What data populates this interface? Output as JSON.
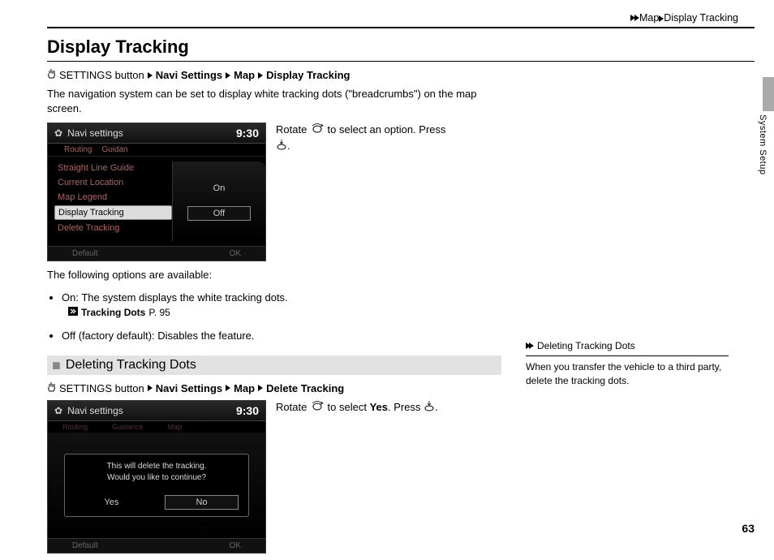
{
  "breadcrumb": {
    "items": [
      "Map",
      "Display Tracking"
    ]
  },
  "page": {
    "title": "Display Tracking",
    "number": "63",
    "section": "System Setup"
  },
  "navpath1": {
    "prefix": "SETTINGS button",
    "items": [
      "Navi Settings",
      "Map",
      "Display Tracking"
    ]
  },
  "intro": "The navigation system can be set to display white tracking dots (\"breadcrumbs\") on the map screen.",
  "screenshot1": {
    "title": "Navi settings",
    "clock": "9:30",
    "tabs": [
      "Routing",
      "Guidan"
    ],
    "list": [
      "Straight Line Guide",
      "Current Location",
      "Map Legend",
      "Display Tracking",
      "Delete Tracking"
    ],
    "active_index": 3,
    "options": [
      "On",
      "Off"
    ],
    "selected_option_index": 1,
    "footer": [
      "Default",
      "OK"
    ]
  },
  "instruct1": {
    "rotate_pre": "Rotate ",
    "rotate_post": " to select an option. Press ",
    "end": "."
  },
  "options_intro": "The following options are available:",
  "opt_on": {
    "label": "On",
    "desc": ": The system displays the white tracking dots."
  },
  "ref1": {
    "label": "Tracking Dots",
    "page": "P. 95"
  },
  "opt_off": {
    "label": "Off",
    "desc": " (factory default): Disables the feature."
  },
  "subheading": "Deleting Tracking Dots",
  "navpath2": {
    "prefix": "SETTINGS button",
    "items": [
      "Navi Settings",
      "Map",
      "Delete Tracking"
    ]
  },
  "screenshot2": {
    "title": "Navi settings",
    "clock": "9:30",
    "tabs": [
      "Routing",
      "Guidance",
      "Map"
    ],
    "msg1": "This will delete the tracking.",
    "msg2": "Would you like to continue?",
    "btns": [
      "Yes",
      "No"
    ],
    "selected_btn_index": 1,
    "footer": [
      "Default",
      "OK"
    ]
  },
  "instruct2": {
    "rotate_pre": "Rotate ",
    "mid1": " to select ",
    "yes": "Yes",
    "mid2": ". Press ",
    "end": "."
  },
  "sidenote": {
    "title": "Deleting Tracking Dots",
    "body": "When you transfer the vehicle to a third party, delete the tracking dots."
  }
}
